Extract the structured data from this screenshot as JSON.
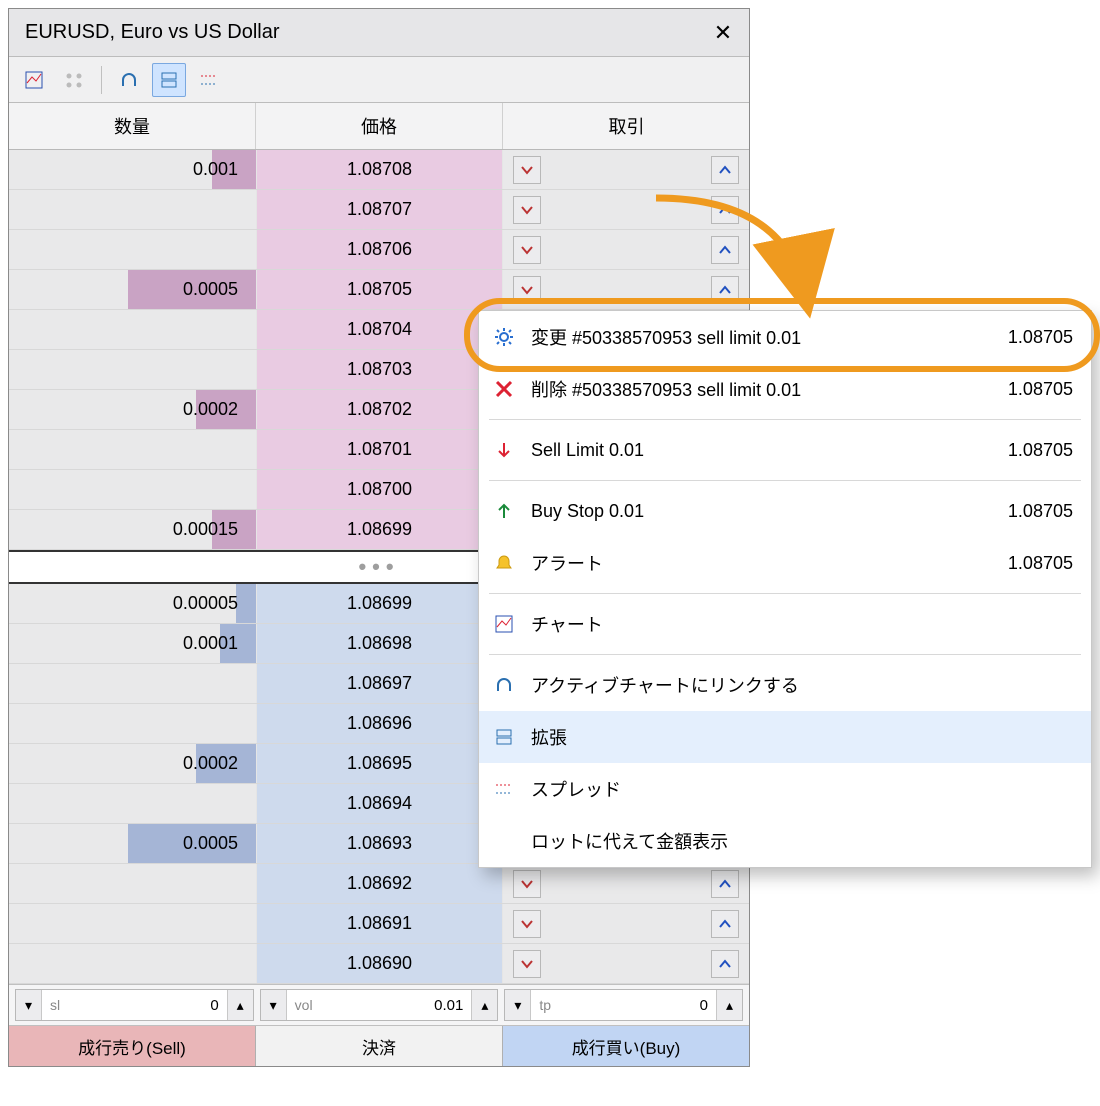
{
  "title": "EURUSD, Euro vs US Dollar",
  "toolbar": {
    "icons": [
      "chart-icon",
      "link-dots-icon",
      "link-chart-icon",
      "expand-icon",
      "spread-icon"
    ]
  },
  "headers": {
    "vol": "数量",
    "price": "価格",
    "trade": "取引"
  },
  "ask_rows": [
    {
      "vol": "0.001",
      "bar": 44,
      "price": "1.08708"
    },
    {
      "vol": "",
      "bar": 0,
      "price": "1.08707"
    },
    {
      "vol": "",
      "bar": 0,
      "price": "1.08706"
    },
    {
      "vol": "0.0005",
      "bar": 128,
      "price": "1.08705"
    },
    {
      "vol": "",
      "bar": 0,
      "price": "1.08704"
    },
    {
      "vol": "",
      "bar": 0,
      "price": "1.08703"
    },
    {
      "vol": "0.0002",
      "bar": 60,
      "price": "1.08702"
    },
    {
      "vol": "",
      "bar": 0,
      "price": "1.08701"
    },
    {
      "vol": "",
      "bar": 0,
      "price": "1.08700"
    },
    {
      "vol": "0.00015",
      "bar": 44,
      "price": "1.08699"
    }
  ],
  "bid_rows": [
    {
      "vol": "0.00005",
      "bar": 20,
      "price": "1.08699"
    },
    {
      "vol": "0.0001",
      "bar": 36,
      "price": "1.08698"
    },
    {
      "vol": "",
      "bar": 0,
      "price": "1.08697"
    },
    {
      "vol": "",
      "bar": 0,
      "price": "1.08696"
    },
    {
      "vol": "0.0002",
      "bar": 60,
      "price": "1.08695"
    },
    {
      "vol": "",
      "bar": 0,
      "price": "1.08694"
    },
    {
      "vol": "0.0005",
      "bar": 128,
      "price": "1.08693"
    },
    {
      "vol": "",
      "bar": 0,
      "price": "1.08692"
    },
    {
      "vol": "",
      "bar": 0,
      "price": "1.08691"
    },
    {
      "vol": "",
      "bar": 0,
      "price": "1.08690"
    }
  ],
  "steppers": {
    "sl": {
      "label": "sl",
      "value": "0"
    },
    "vol": {
      "label": "vol",
      "value": "0.01"
    },
    "tp": {
      "label": "tp",
      "value": "0"
    }
  },
  "buttons": {
    "sell": "成行売り(Sell)",
    "close": "決済",
    "buy": "成行買い(Buy)"
  },
  "context_menu": {
    "items": [
      {
        "icon": "gear",
        "label": "変更 #50338570953 sell limit 0.01",
        "value": "1.08705",
        "highlight": true
      },
      {
        "icon": "del",
        "label": "削除 #50338570953 sell limit 0.01",
        "value": "1.08705"
      },
      {
        "sep": true
      },
      {
        "icon": "sell",
        "label": "Sell Limit 0.01",
        "value": "1.08705"
      },
      {
        "sep": true
      },
      {
        "icon": "buy",
        "label": "Buy Stop 0.01",
        "value": "1.08705"
      },
      {
        "icon": "bell",
        "label": "アラート",
        "value": "1.08705"
      },
      {
        "sep": true
      },
      {
        "icon": "chart",
        "label": "チャート",
        "value": ""
      },
      {
        "sep": true
      },
      {
        "icon": "link",
        "label": "アクティブチャートにリンクする",
        "value": ""
      },
      {
        "icon": "expand",
        "label": "拡張",
        "value": "",
        "checked": true
      },
      {
        "icon": "spread",
        "label": "スプレッド",
        "value": ""
      },
      {
        "icon": "",
        "label": "ロットに代えて金額表示",
        "value": ""
      }
    ]
  }
}
